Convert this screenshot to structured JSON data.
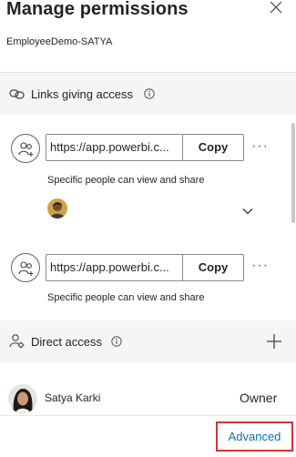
{
  "header": {
    "title": "Manage permissions",
    "subtitle": "EmployeeDemo-SATYA"
  },
  "links_section": {
    "label": "Links giving access",
    "links": [
      {
        "url": "https://app.powerbi.c...",
        "copy_label": "Copy",
        "more_label": "···",
        "description": "Specific people can view and share"
      },
      {
        "url": "https://app.powerbi.c...",
        "copy_label": "Copy",
        "more_label": "···",
        "description": "Specific people can view and share"
      }
    ]
  },
  "direct_access": {
    "label": "Direct access",
    "users": [
      {
        "name": "Satya Karki",
        "role": "Owner"
      }
    ]
  },
  "footer": {
    "advanced_label": "Advanced"
  },
  "colors": {
    "accent": "#0f6cbd",
    "highlight_border": "#d13438",
    "section_bg": "#f5f5f5"
  },
  "icons": {
    "close": "close-icon",
    "links": "link-icon",
    "info": "info-icon",
    "people": "people-add-icon",
    "chevron": "chevron-down-icon",
    "direct": "person-settings-icon",
    "add": "plus-icon"
  }
}
